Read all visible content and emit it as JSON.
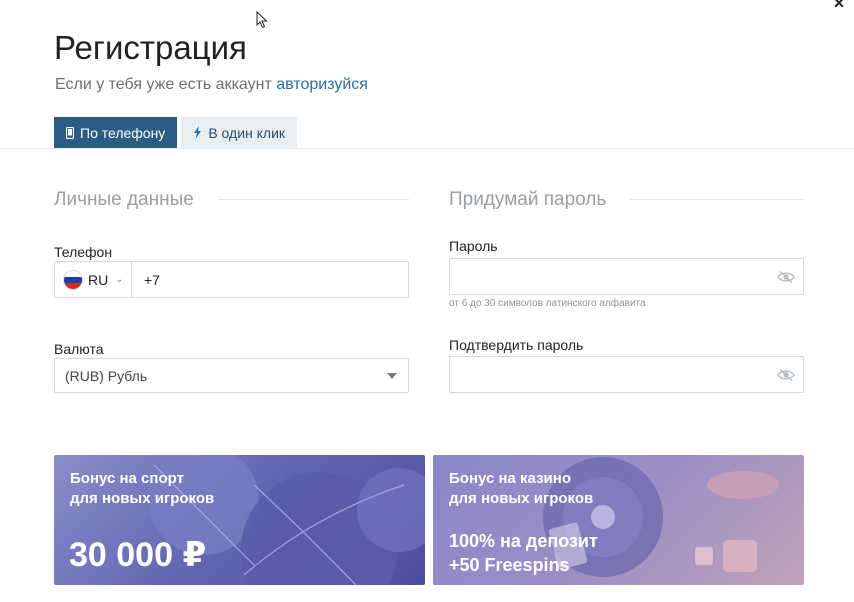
{
  "header": {
    "close_label": "×",
    "title": "Регистрация",
    "subtitle_text": "Если у тебя уже есть аккаунт ",
    "login_link": "авторизуйся"
  },
  "tabs": [
    {
      "label": "По телефону",
      "icon": "phone-icon",
      "active": true
    },
    {
      "label": "В один клик",
      "icon": "lightning-icon",
      "active": false
    }
  ],
  "personal": {
    "section_title": "Личные данные",
    "phone_label": "Телефон",
    "country_code": "RU",
    "phone_value": "+7",
    "currency_label": "Валюта",
    "currency_value": "(RUB) Рубль"
  },
  "password": {
    "section_title": "Придумай пароль",
    "password_label": "Пароль",
    "password_hint": "от 6 до 30 символов латинского алфавита",
    "confirm_label": "Подтвердить пароль"
  },
  "banners": {
    "sport": {
      "line1": "Бонус на спорт",
      "line2": "для новых игроков",
      "amount": "30 000 ₽"
    },
    "casino": {
      "line1": "Бонус на казино",
      "line2": "для новых игроков",
      "offer1": "100% на депозит",
      "offer2": "+50 Freespins"
    }
  },
  "colors": {
    "accent": "#2b5d82",
    "link": "#2e6d9e",
    "tab_inactive": "#e9eef2"
  }
}
